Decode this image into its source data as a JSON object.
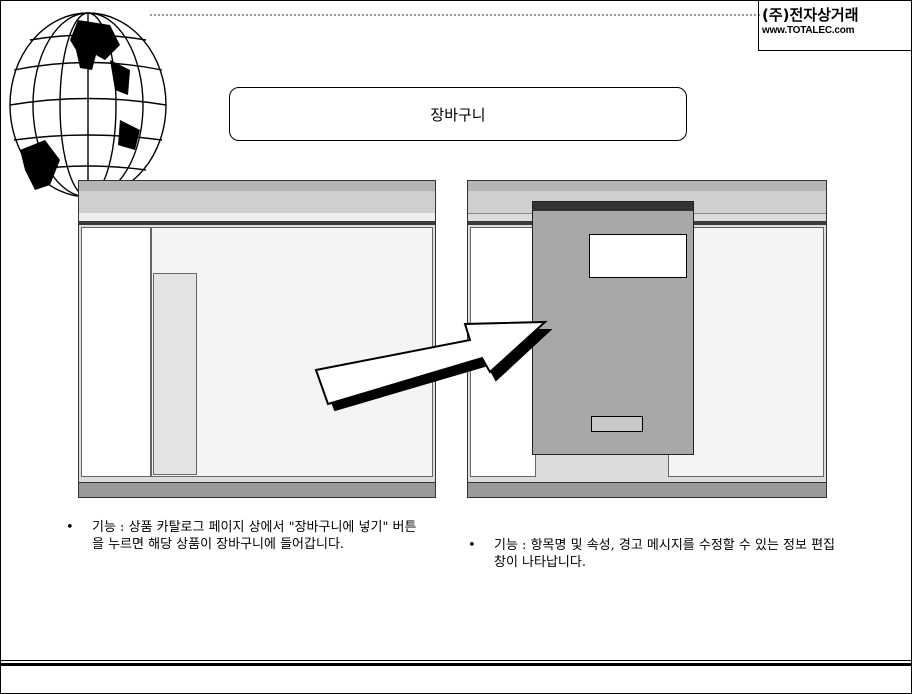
{
  "brand": {
    "company_name": "(주)전자상거래",
    "url": "www.TOTALEC.com"
  },
  "slide": {
    "title": "장바구니"
  },
  "icons": {
    "globe": "globe-icon",
    "arrow": "arrow-right-icon"
  },
  "left_screenshot": {
    "description_bullet": "기능 : 상품 카탈로그 페이지 상에서 \"장바구니에 넣기\" 버튼을 누르면 해당 상품이 장바구니에 들어갑니다."
  },
  "right_screenshot": {
    "description_bullet": "기능 : 항목명 및 속성, 경고 메시지를 수정할 수 있는 정보 편집 창이 나타납니다."
  },
  "colors": {
    "screenshot_bg": "#dcdcdc",
    "dialog_bg": "#a8a8a8",
    "dark_bar": "#3a3a3a"
  }
}
